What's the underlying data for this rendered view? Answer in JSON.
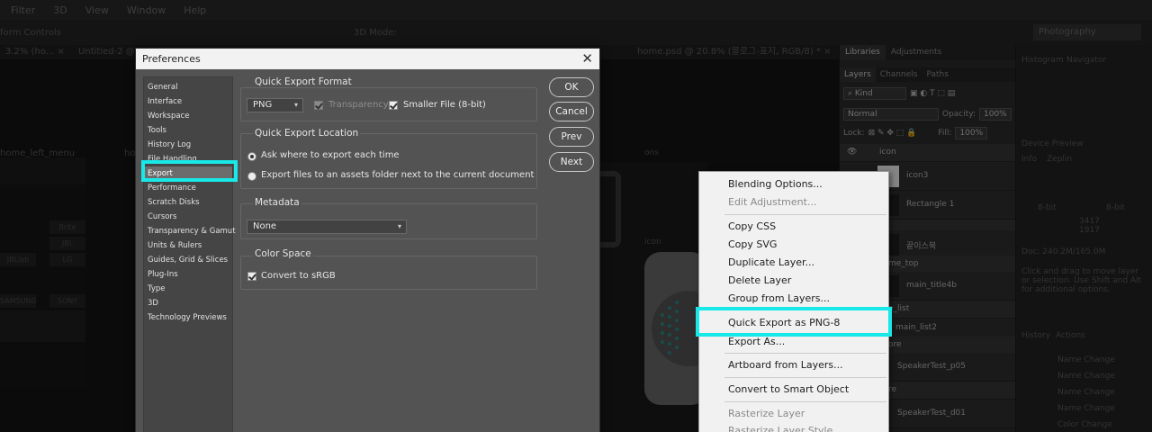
{
  "menubar": [
    "Filter",
    "3D",
    "View",
    "Window",
    "Help"
  ],
  "options_bar": {
    "label": "form Controls",
    "mode3d": "3D Mode:",
    "workspace": "Photography"
  },
  "doc_tabs": {
    "left": [
      "3.2% (ho... ×",
      "Untitled-2 @ 200...",
      "×"
    ],
    "right": "home.psd @ 20.8% (블로그-표지, RGB/8) * ×"
  },
  "canvas_labels": {
    "home_left_menu": "home_left_menu",
    "icon": "icon",
    "ons": "ons",
    "ho": "ho"
  },
  "left_tiles": [
    "Brite",
    "JBL",
    "JBLlab",
    "LG",
    "SAMSUNG",
    "SONY"
  ],
  "dialog": {
    "title": "Preferences",
    "nav": [
      "General",
      "Interface",
      "Workspace",
      "Tools",
      "History Log",
      "File Handling",
      "Export",
      "Performance",
      "Scratch Disks",
      "Cursors",
      "Transparency & Gamut",
      "Units & Rulers",
      "Guides, Grid & Slices",
      "Plug-Ins",
      "Type",
      "3D",
      "Technology Previews"
    ],
    "selected_nav": "Export",
    "quick_export_format": {
      "title": "Quick Export Format",
      "format": "PNG",
      "transparency": "Transparency",
      "smaller_file": "Smaller File (8-bit)"
    },
    "quick_export_location": {
      "title": "Quick Export Location",
      "ask": "Ask where to export each time",
      "assets": "Export files to an assets folder next to the current document"
    },
    "metadata": {
      "title": "Metadata",
      "value": "None"
    },
    "color_space": {
      "title": "Color Space",
      "convert": "Convert to sRGB"
    },
    "buttons": {
      "ok": "OK",
      "cancel": "Cancel",
      "prev": "Prev",
      "next": "Next"
    }
  },
  "context_menu": {
    "items": [
      {
        "label": "Blending Options...",
        "disabled": false
      },
      {
        "label": "Edit Adjustment...",
        "disabled": true
      },
      {
        "label": "Copy CSS",
        "disabled": false
      },
      {
        "label": "Copy SVG",
        "disabled": false
      },
      {
        "label": "Duplicate Layer...",
        "disabled": false
      },
      {
        "label": "Delete Layer",
        "disabled": false
      },
      {
        "label": "Group from Layers...",
        "disabled": false
      },
      {
        "label": "Quick Export as PNG-8",
        "disabled": false
      },
      {
        "label": "Export As...",
        "disabled": false
      },
      {
        "label": "Artboard from Layers...",
        "disabled": false
      },
      {
        "label": "Convert to Smart Object",
        "disabled": false
      },
      {
        "label": "Rasterize Layer",
        "disabled": true
      },
      {
        "label": "Rasterize Layer Style",
        "disabled": true
      }
    ],
    "highlighted": "Quick Export as PNG-8"
  },
  "panels": {
    "top_tabs": [
      "Libraries",
      "Adjustments"
    ],
    "layer_tabs": [
      "Layers",
      "Channels",
      "Paths"
    ],
    "kind": "Kind",
    "blend_mode": "Normal",
    "opacity_label": "Opacity:",
    "opacity": "100%",
    "lock_label": "Lock:",
    "fill_label": "Fill:",
    "fill": "100%",
    "layers": [
      {
        "name": "icon",
        "group": true
      },
      {
        "name": "icon3",
        "group": false
      },
      {
        "name": "Rectangle 1",
        "group": false
      },
      {
        "name": "",
        "group": true
      },
      {
        "name": "끝이스북",
        "group": false
      },
      {
        "name": "me_top",
        "group": true
      },
      {
        "name": "main_title4b",
        "group": false
      },
      {
        "name": "e_list",
        "group": true
      },
      {
        "name": "main_list2",
        "group": false
      },
      {
        "name": "ore",
        "group": true
      },
      {
        "name": "SpeakerTest_p05",
        "group": false
      },
      {
        "name": "re",
        "group": true
      },
      {
        "name": "SpeakerTest_d01",
        "group": false
      }
    ],
    "right_tabs": [
      "Histogram",
      "Navigator"
    ],
    "device_preview": "Device Preview",
    "info_tabs": [
      "Info",
      "Zeplin"
    ],
    "info_values": {
      "w": "3417",
      "h": "1917",
      "bits_left": "8-bit",
      "bits_right": "8-bit"
    },
    "doc": "Doc: 240.2M/165.0M",
    "hint": "Click and drag to move layer or selection. Use Shift and Alt for additional options.",
    "history_tabs": [
      "History",
      "Actions"
    ],
    "history": [
      "Name Change",
      "Name Change",
      "Name Change",
      "Name Change",
      "Color Change"
    ]
  }
}
